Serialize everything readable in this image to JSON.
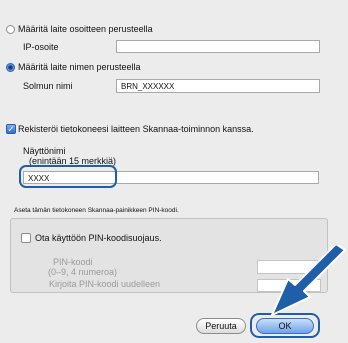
{
  "radio_ip": {
    "label": "Määritä laite osoitteen perusteella",
    "selected": false
  },
  "ip_label": "IP-osoite",
  "ip_value": "",
  "radio_name": {
    "label": "Määritä laite nimen perusteella",
    "selected": true
  },
  "node_label": "Solmun nimi",
  "node_value": "BRN_XXXXXX",
  "register_checkbox": {
    "label": "Rekisteröi tietokoneesi laitteen Skannaa-toiminnon kanssa.",
    "checked": true
  },
  "display_name_label_line1": "Näyttönimi",
  "display_name_label_line2": "(enintään 15 merkkiä)",
  "display_name_value": "XXXX",
  "pin_group_title": "Aseta tämän tietokoneen Skannaa-painikkeen PIN-koodi.",
  "pin_enable_checkbox": {
    "label": "Ota käyttöön PIN-koodisuojaus.",
    "checked": false
  },
  "pin_label_line1": "PIN-koodi",
  "pin_label_line2": "(0–9, 4 numeroa)",
  "pin_value": "",
  "pin_repeat_label": "Kirjoita PIN-koodi uudelleen",
  "pin_repeat_value": "",
  "buttons": {
    "cancel": "Peruuta",
    "ok": "OK"
  },
  "colors": {
    "highlight": "#1f5ea8",
    "arrow": "#1f5ea8"
  }
}
